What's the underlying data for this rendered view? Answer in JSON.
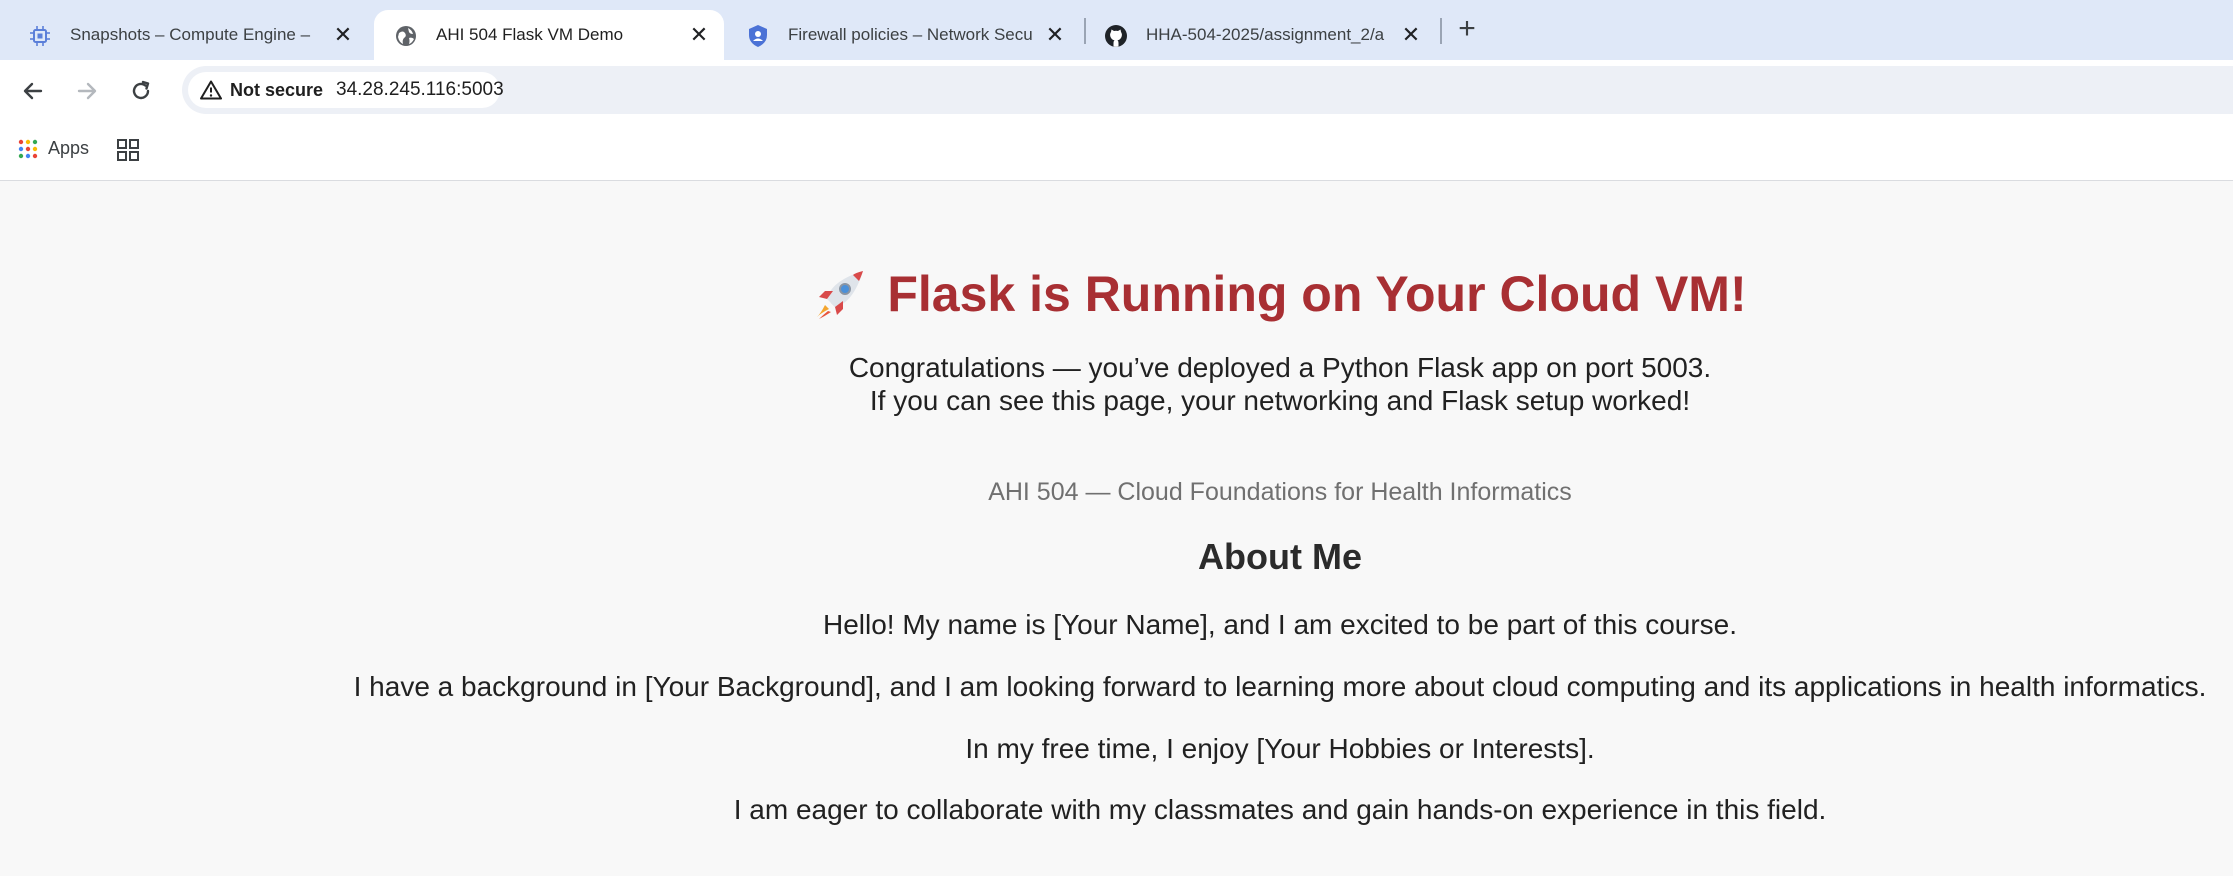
{
  "browser": {
    "tabs": [
      {
        "title": "Snapshots – Compute Engine –",
        "icon": "compute-engine-icon",
        "active": false
      },
      {
        "title": "AHI 504 Flask VM Demo",
        "icon": "globe-icon",
        "active": true
      },
      {
        "title": "Firewall policies – Network Secu",
        "icon": "shield-icon",
        "active": false
      },
      {
        "title": "HHA-504-2025/assignment_2/a",
        "icon": "github-icon",
        "active": false
      }
    ],
    "new_tab_label": "+",
    "close_glyph": "✕",
    "security_label": "Not secure",
    "url": "34.28.245.116:5003",
    "bookmarks": {
      "apps_label": "Apps"
    },
    "colors": {
      "tabstrip_bg": "#dfe8f8",
      "omnibox_bg": "#edf0f6"
    }
  },
  "page": {
    "headline": "Flask is Running on Your Cloud VM!",
    "subline1": "Congratulations — you’ve deployed a Python Flask app on port 5003.",
    "subline2": "If you can see this page, your networking and Flask setup worked!",
    "course": "AHI 504 — Cloud Foundations for Health Informatics",
    "about_heading": "About Me",
    "paragraphs": [
      "Hello! My name is [Your Name], and I am excited to be part of this course.",
      "I have a background in [Your Background], and I am looking forward to learning more about cloud computing and its applications in health informatics.",
      "In my free time, I enjoy [Your Hobbies or Interests].",
      "I am eager to collaborate with my classmates and gain hands-on experience in this field."
    ],
    "colors": {
      "headline": "#a82f33",
      "course": "#707070",
      "background": "#f8f8f8"
    }
  }
}
